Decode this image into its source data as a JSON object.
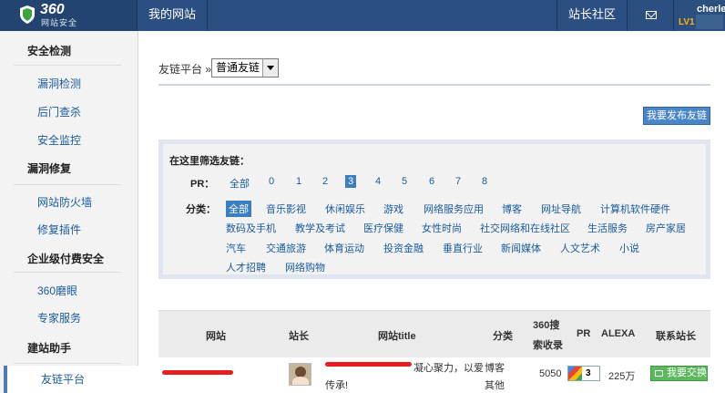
{
  "header": {
    "brand": "360",
    "brand_sub": "网站安全",
    "nav_mysite": "我的网站",
    "nav_community": "站长社区",
    "user_name": "cherle",
    "user_level": "LV1"
  },
  "sidebar": {
    "sections": [
      {
        "title": "安全检测",
        "items": [
          "漏洞检测",
          "后门查杀",
          "安全监控"
        ]
      },
      {
        "title": "漏洞修复",
        "items": [
          "网站防火墙",
          "修复插件"
        ]
      },
      {
        "title": "企业级付费安全",
        "items": [
          "360磨眼",
          "专家服务"
        ]
      },
      {
        "title": "建站助手",
        "items": [
          "友链平台"
        ]
      }
    ],
    "active_item": "友链平台"
  },
  "main": {
    "breadcrumb_label": "友链平台 »",
    "select_value": "普通友链",
    "publish_button": "我要发布友链",
    "filter": {
      "title": "在这里筛选友链：",
      "pr_label": "PR：",
      "pr_options": [
        "全部",
        "0",
        "1",
        "2",
        "3",
        "4",
        "5",
        "6",
        "7",
        "8"
      ],
      "pr_selected": "3",
      "cat_label": "分类：",
      "categories": [
        "全部",
        "音乐影视",
        "休闲娱乐",
        "游戏",
        "网络服务应用",
        "博客",
        "网址导航",
        "计算机软件硬件",
        "数码及手机",
        "教学及考试",
        "医疗保健",
        "女性时尚",
        "社交网络和在线社区",
        "生活服务",
        "房产家居",
        "汽车",
        "交通旅游",
        "体育运动",
        "投资金融",
        "垂直行业",
        "新闻媒体",
        "人文艺术",
        "小说",
        "人才招聘",
        "网络购物"
      ],
      "cat_selected": "全部"
    },
    "table": {
      "headers": {
        "site": "网站",
        "owner": "站长",
        "title": "网站title",
        "category": "分类",
        "indexed_line1": "360搜",
        "indexed_line2": "索收录",
        "pr": "PR",
        "alexa": "ALEXA",
        "contact": "联系站长"
      },
      "rows": [
        {
          "title_line1": "凝心聚力，以爱",
          "title_line2": "传承!",
          "category_line1": "博客",
          "category_line2": "其他",
          "indexed": "5050",
          "pr": "3",
          "alexa": "225万",
          "action": "我要交换"
        }
      ]
    }
  },
  "colors": {
    "topbar": "#2b4f80",
    "link": "#1a5b9c",
    "selected": "#3b7fc2",
    "swap_button": "#5cb85c",
    "redaction": "#e61e1e"
  }
}
